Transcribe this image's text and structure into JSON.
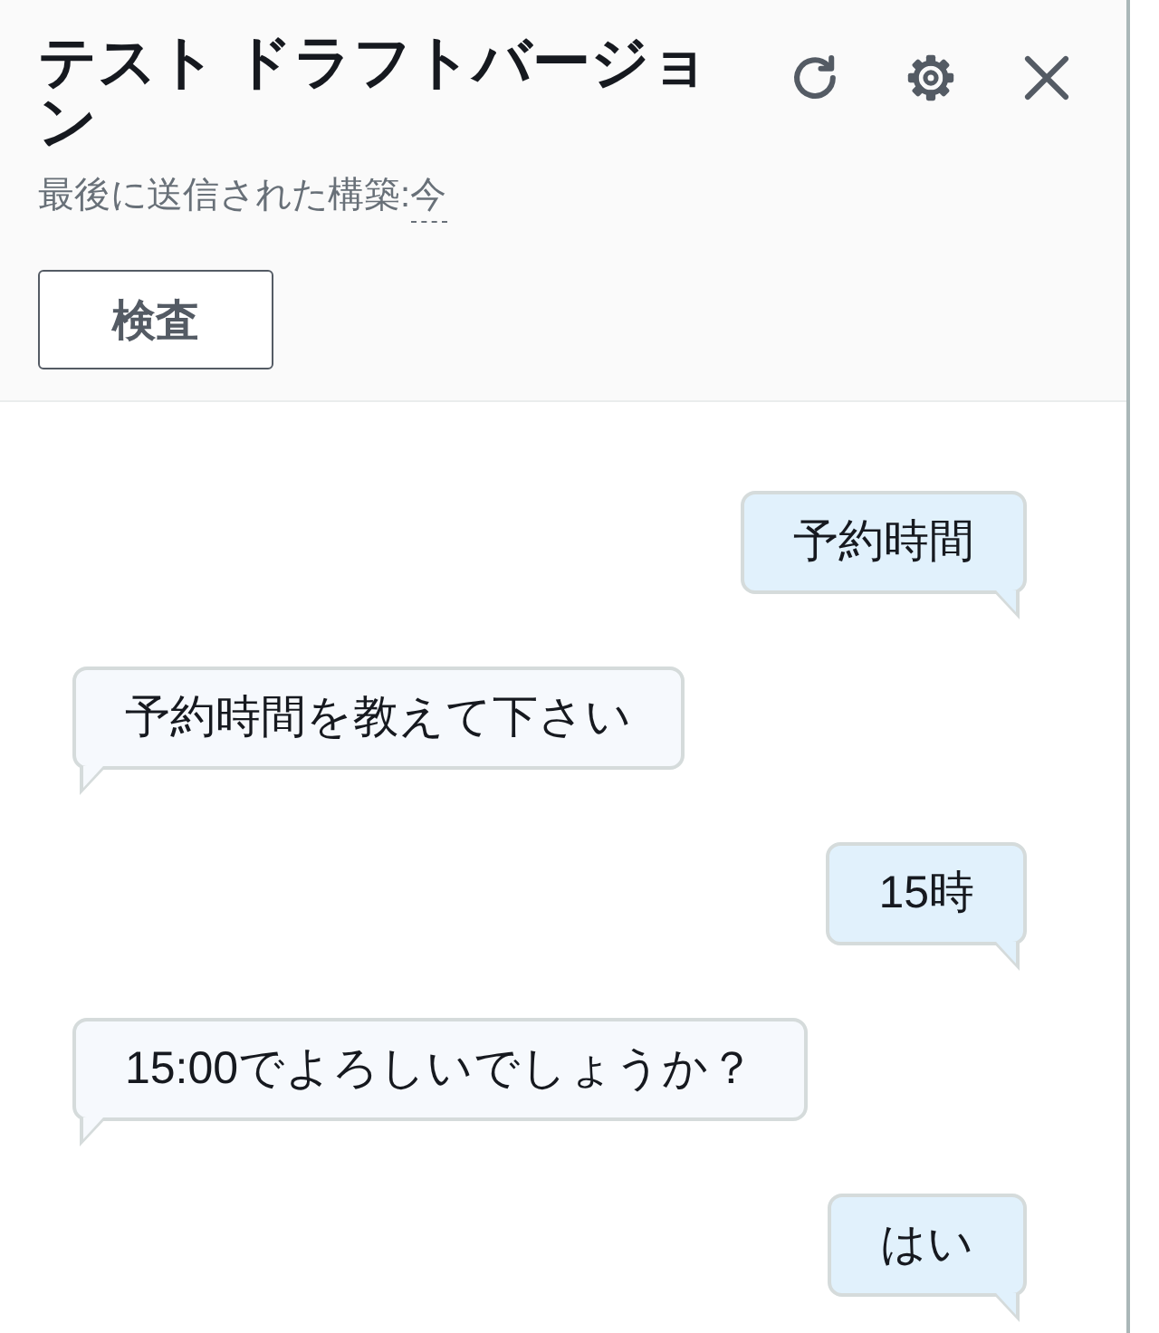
{
  "header": {
    "title": "テスト ドラフトバージョン",
    "last_build_label": "最後に送信された構築:",
    "last_build_time": "今",
    "inspect_button": "検査"
  },
  "messages": [
    {
      "kind": "user",
      "text": "予約時間"
    },
    {
      "kind": "bot",
      "text": "予約時間を教えて下さい"
    },
    {
      "kind": "user",
      "text": "15時"
    },
    {
      "kind": "bot",
      "text": "15:00でよろしいでしょうか？"
    },
    {
      "kind": "user",
      "text": "はい"
    }
  ]
}
